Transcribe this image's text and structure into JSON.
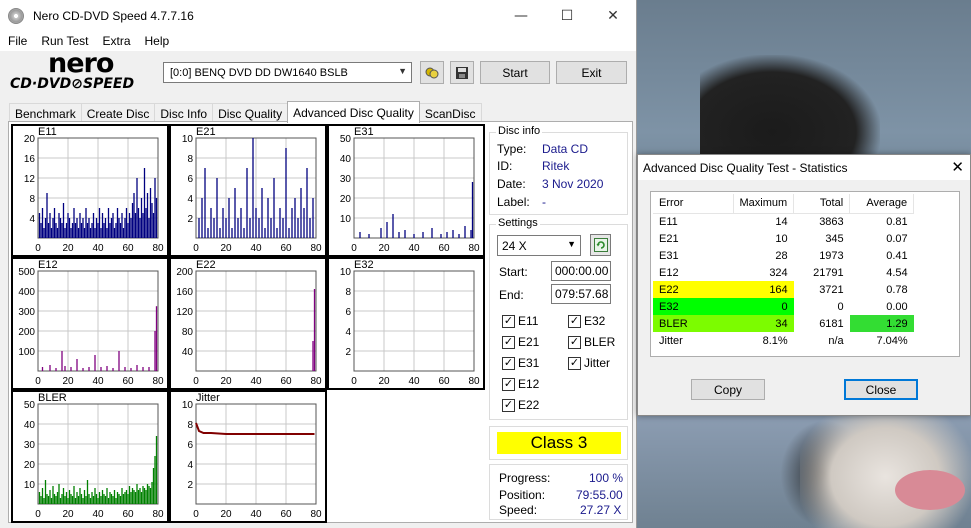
{
  "app": {
    "title": "Nero CD-DVD Speed 4.7.7.16",
    "logo_top": "nero",
    "logo_bottom": "CD·DVD⊘SPEED"
  },
  "window_buttons": {
    "minimize": "—",
    "maximize": "☐",
    "close": "✕"
  },
  "menu": [
    "File",
    "Run Test",
    "Extra",
    "Help"
  ],
  "toolbar": {
    "drive": "[0:0]   BENQ DVD DD DW1640 BSLB",
    "start": "Start",
    "exit": "Exit"
  },
  "tabs": [
    "Benchmark",
    "Create Disc",
    "Disc Info",
    "Disc Quality",
    "Advanced Disc Quality",
    "ScanDisc"
  ],
  "active_tab": "Advanced Disc Quality",
  "disc_info": {
    "heading": "Disc info",
    "type_label": "Type:",
    "type": "Data CD",
    "id_label": "ID:",
    "id": "Ritek",
    "date_label": "Date:",
    "date": "3 Nov 2020",
    "label_label": "Label:",
    "label": "-"
  },
  "settings": {
    "heading": "Settings",
    "speed": "24 X",
    "start_label": "Start:",
    "start": "000:00.00",
    "end_label": "End:",
    "end": "079:57.68",
    "checks": [
      {
        "label": "E11",
        "checked": true
      },
      {
        "label": "E32",
        "checked": true
      },
      {
        "label": "E21",
        "checked": true
      },
      {
        "label": "BLER",
        "checked": true
      },
      {
        "label": "E31",
        "checked": true
      },
      {
        "label": "Jitter",
        "checked": true
      },
      {
        "label": "E12",
        "checked": true
      },
      {
        "label": "E22",
        "checked": true
      }
    ]
  },
  "class": "Class 3",
  "progress": {
    "progress_label": "Progress:",
    "progress": "100 %",
    "position_label": "Position:",
    "position": "79:55.00",
    "speed_label": "Speed:",
    "speed": "27.27 X"
  },
  "dialog": {
    "title": "Advanced Disc Quality Test - Statistics",
    "close": "✕",
    "headers": [
      "Error",
      "Maximum",
      "Total",
      "Average"
    ],
    "rows": [
      {
        "error": "E11",
        "max": "14",
        "total": "3863",
        "avg": "0.81",
        "hl": ""
      },
      {
        "error": "E21",
        "max": "10",
        "total": "345",
        "avg": "0.07",
        "hl": ""
      },
      {
        "error": "E31",
        "max": "28",
        "total": "1973",
        "avg": "0.41",
        "hl": ""
      },
      {
        "error": "E12",
        "max": "324",
        "total": "21791",
        "avg": "4.54",
        "hl": ""
      },
      {
        "error": "E22",
        "max": "164",
        "total": "3721",
        "avg": "0.78",
        "hl": "yellow"
      },
      {
        "error": "E32",
        "max": "0",
        "total": "0",
        "avg": "0.00",
        "hl": "green"
      },
      {
        "error": "BLER",
        "max": "34",
        "total": "6181",
        "avg": "1.29",
        "hl": "lime"
      },
      {
        "error": "Jitter",
        "max": "8.1%",
        "total": "n/a",
        "avg": "7.04%",
        "hl": ""
      }
    ],
    "copy": "Copy",
    "close_btn": "Close"
  },
  "chart_data": [
    {
      "type": "bar",
      "title": "E11",
      "color": "#000080",
      "ylim": [
        0,
        20
      ],
      "yticks": [
        4,
        8,
        12,
        16,
        20
      ],
      "xticks": [
        0,
        20,
        40,
        60,
        80
      ],
      "x": [
        1,
        2,
        3,
        4,
        5,
        6,
        7,
        8,
        9,
        10,
        11,
        12,
        13,
        14,
        15,
        16,
        17,
        18,
        19,
        20,
        21,
        22,
        23,
        24,
        25,
        26,
        27,
        28,
        29,
        30,
        31,
        32,
        33,
        34,
        35,
        36,
        37,
        38,
        39,
        40,
        41,
        42,
        43,
        44,
        45,
        46,
        47,
        48,
        49,
        50,
        51,
        52,
        53,
        54,
        55,
        56,
        57,
        58,
        59,
        60,
        61,
        62,
        63,
        64,
        65,
        66,
        67,
        68,
        69,
        70,
        71,
        72,
        73,
        74,
        75,
        76,
        77,
        78,
        79
      ],
      "values": [
        5,
        3,
        6,
        2,
        4,
        9,
        3,
        5,
        2,
        4,
        6,
        3,
        2,
        5,
        4,
        3,
        7,
        2,
        3,
        5,
        4,
        2,
        3,
        6,
        3,
        4,
        2,
        5,
        3,
        4,
        2,
        6,
        3,
        4,
        2,
        3,
        5,
        2,
        4,
        3,
        6,
        2,
        5,
        3,
        4,
        2,
        6,
        3,
        4,
        5,
        2,
        3,
        6,
        4,
        3,
        5,
        2,
        4,
        6,
        3,
        5,
        4,
        7,
        9,
        5,
        12,
        6,
        4,
        8,
        5,
        14,
        6,
        9,
        4,
        10,
        7,
        5,
        12,
        8
      ]
    },
    {
      "type": "bar",
      "title": "E21",
      "color": "#000080",
      "ylim": [
        0,
        10
      ],
      "yticks": [
        2,
        4,
        6,
        8,
        10
      ],
      "xticks": [
        0,
        20,
        40,
        60,
        80
      ],
      "x": [
        2,
        4,
        6,
        8,
        10,
        12,
        14,
        16,
        18,
        20,
        22,
        24,
        26,
        28,
        30,
        32,
        34,
        36,
        38,
        40,
        42,
        44,
        46,
        48,
        50,
        52,
        54,
        56,
        58,
        60,
        62,
        64,
        66,
        68,
        70,
        72,
        74,
        76,
        78
      ],
      "values": [
        2,
        4,
        7,
        1,
        3,
        2,
        6,
        1,
        3,
        2,
        4,
        1,
        5,
        2,
        3,
        1,
        7,
        2,
        10,
        3,
        2,
        5,
        1,
        4,
        2,
        6,
        1,
        3,
        2,
        9,
        1,
        3,
        4,
        2,
        5,
        3,
        7,
        2,
        4
      ]
    },
    {
      "type": "bar",
      "title": "E31",
      "color": "#000080",
      "ylim": [
        0,
        50
      ],
      "yticks": [
        10,
        20,
        30,
        40,
        50
      ],
      "xticks": [
        0,
        20,
        40,
        60,
        80
      ],
      "x": [
        4,
        10,
        18,
        22,
        26,
        30,
        34,
        40,
        46,
        52,
        58,
        62,
        66,
        70,
        74,
        78,
        79
      ],
      "values": [
        3,
        2,
        5,
        8,
        12,
        3,
        4,
        2,
        3,
        5,
        2,
        3,
        4,
        2,
        6,
        4,
        28
      ]
    },
    {
      "type": "bar",
      "title": "E12",
      "color": "#800080",
      "ylim": [
        0,
        500
      ],
      "yticks": [
        100,
        200,
        300,
        400,
        500
      ],
      "xticks": [
        0,
        20,
        40,
        60,
        80
      ],
      "x": [
        3,
        8,
        12,
        16,
        18,
        22,
        26,
        30,
        34,
        38,
        42,
        46,
        50,
        54,
        58,
        62,
        66,
        70,
        74,
        78,
        79
      ],
      "values": [
        20,
        30,
        15,
        100,
        25,
        20,
        60,
        15,
        20,
        80,
        20,
        25,
        15,
        100,
        20,
        15,
        30,
        20,
        20,
        200,
        324
      ]
    },
    {
      "type": "bar",
      "title": "E22",
      "color": "#800080",
      "ylim": [
        0,
        200
      ],
      "yticks": [
        40,
        80,
        120,
        160,
        200
      ],
      "xticks": [
        0,
        20,
        40,
        60,
        80
      ],
      "x": [
        78,
        79
      ],
      "values": [
        60,
        164
      ]
    },
    {
      "type": "bar",
      "title": "E32",
      "color": "#800080",
      "ylim": [
        0,
        10
      ],
      "yticks": [
        2,
        4,
        6,
        8,
        10
      ],
      "xticks": [
        0,
        20,
        40,
        60,
        80
      ],
      "x": [],
      "values": []
    },
    {
      "type": "bar",
      "title": "BLER",
      "color": "#008000",
      "ylim": [
        0,
        50
      ],
      "yticks": [
        10,
        20,
        30,
        40,
        50
      ],
      "xticks": [
        0,
        20,
        40,
        60,
        80
      ],
      "x": [
        1,
        2,
        3,
        4,
        5,
        6,
        7,
        8,
        9,
        10,
        11,
        12,
        13,
        14,
        15,
        16,
        17,
        18,
        19,
        20,
        21,
        22,
        23,
        24,
        25,
        26,
        27,
        28,
        29,
        30,
        31,
        32,
        33,
        34,
        35,
        36,
        37,
        38,
        39,
        40,
        41,
        42,
        43,
        44,
        45,
        46,
        47,
        48,
        49,
        50,
        51,
        52,
        53,
        54,
        55,
        56,
        57,
        58,
        59,
        60,
        61,
        62,
        63,
        64,
        65,
        66,
        67,
        68,
        69,
        70,
        71,
        72,
        73,
        74,
        75,
        76,
        77,
        78,
        79
      ],
      "values": [
        6,
        4,
        8,
        3,
        12,
        5,
        4,
        7,
        3,
        9,
        5,
        4,
        6,
        10,
        3,
        5,
        8,
        4,
        6,
        3,
        7,
        5,
        4,
        9,
        3,
        6,
        4,
        8,
        5,
        3,
        7,
        4,
        12,
        5,
        3,
        6,
        4,
        8,
        5,
        3,
        6,
        4,
        7,
        5,
        4,
        8,
        3,
        6,
        5,
        4,
        7,
        3,
        6,
        5,
        4,
        8,
        5,
        6,
        7,
        5,
        9,
        6,
        8,
        7,
        6,
        10,
        7,
        8,
        6,
        9,
        8,
        7,
        10,
        9,
        8,
        11,
        18,
        24,
        34
      ]
    },
    {
      "type": "line",
      "title": "Jitter",
      "color": "#800000",
      "ylim": [
        0,
        10
      ],
      "yticks": [
        2,
        4,
        6,
        8,
        10
      ],
      "xticks": [
        0,
        20,
        40,
        60,
        80
      ],
      "x": [
        0,
        2,
        5,
        10,
        20,
        30,
        40,
        50,
        60,
        70,
        79
      ],
      "values": [
        8.1,
        7.3,
        7.1,
        7.1,
        7.0,
        7.0,
        7.0,
        7.0,
        7.0,
        7.0,
        7.0
      ]
    }
  ]
}
